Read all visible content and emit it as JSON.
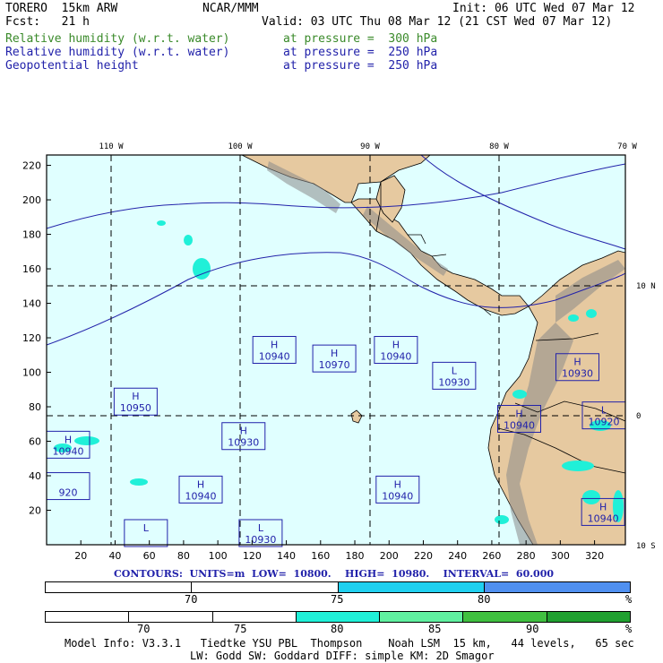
{
  "header": {
    "model": "TORERO  15km ARW",
    "org": "NCAR/MMM",
    "init": "Init: 06 UTC Wed 07 Mar 12",
    "fcst": "Fcst:   21 h",
    "valid": "Valid: 03 UTC Thu 08 Mar 12 (21 CST Wed 07 Mar 12)",
    "fields": [
      {
        "name": "Relative humidity (w.r.t. water)",
        "level": "at pressure =  300 hPa",
        "color": "#3a8a2a"
      },
      {
        "name": "Relative humidity (w.r.t. water)",
        "level": "at pressure =  250 hPa",
        "color": "#2222aa"
      },
      {
        "name": "Geopotential height",
        "level": "at pressure =  250 hPa",
        "color": "#2222aa"
      }
    ]
  },
  "map": {
    "lon_labels": [
      "110 W",
      "100 W",
      "90 W",
      "80 W",
      "70 W"
    ],
    "lat_labels": [
      "10 N",
      "0",
      "10 S"
    ],
    "y_ticks": [
      "220",
      "200",
      "180",
      "160",
      "140",
      "120",
      "100",
      "80",
      "60",
      "40",
      "20"
    ],
    "x_ticks": [
      "20",
      "40",
      "60",
      "80",
      "100",
      "120",
      "140",
      "160",
      "180",
      "200",
      "220",
      "240",
      "260",
      "280",
      "300",
      "320"
    ],
    "ocean_color": "#e0ffff",
    "land_color": "#e6c9a0",
    "contour_color": "#2222aa",
    "highs_lows": [
      {
        "type": "H",
        "value": "10940",
        "gx": 133,
        "gy": 113
      },
      {
        "type": "H",
        "value": "10970",
        "gx": 168,
        "gy": 108
      },
      {
        "type": "H",
        "value": "10940",
        "gx": 204,
        "gy": 113
      },
      {
        "type": "L",
        "value": "10930",
        "gx": 238,
        "gy": 98
      },
      {
        "type": "H",
        "value": "10930",
        "gx": 310,
        "gy": 103
      },
      {
        "type": "H",
        "value": "10950",
        "gx": 52,
        "gy": 83
      },
      {
        "type": "H",
        "value": "10940",
        "gx": 276,
        "gy": 73
      },
      {
        "type": "L",
        "value": "10920",
        "gx": 330,
        "gy": 75
      },
      {
        "type": "H",
        "value": "10930",
        "gx": 115,
        "gy": 63
      },
      {
        "type": "H",
        "value": "10940",
        "gx": 6,
        "gy": 58
      },
      {
        "type": "H",
        "value": "10940",
        "gx": 90,
        "gy": 32
      },
      {
        "type": "H",
        "value": "10940",
        "gx": 205,
        "gy": 32
      },
      {
        "type": "H",
        "value": "10940",
        "gx": 325,
        "gy": 19
      },
      {
        "type": "",
        "value": "920",
        "gx": 6,
        "gy": 34
      },
      {
        "type": "L",
        "value": "",
        "gx": 58,
        "gy": 3
      },
      {
        "type": "L",
        "value": "10930",
        "gx": 125,
        "gy": 3
      }
    ]
  },
  "contour_info": {
    "label": "CONTOURS:  UNITS=m  LOW=  10800.    HIGH=  10980.    INTERVAL=  60.000"
  },
  "colorbar1": {
    "labels": [
      "70",
      "75",
      "80",
      "%"
    ],
    "colors": [
      "#ffffff",
      "#ffffff",
      "#20d0f0",
      "#5090f0"
    ]
  },
  "colorbar2": {
    "labels": [
      "70",
      "75",
      "80",
      "85",
      "90",
      "%"
    ],
    "colors": [
      "#ffffff",
      "#ffffff",
      "#ffffff",
      "#20f0d8",
      "#60f0a0",
      "#40c040",
      "#20a030"
    ]
  },
  "footer": {
    "line1": "Model Info: V3.3.1   Tiedtke YSU PBL  Thompson    Noah LSM  15 km,   44 levels,   65 sec",
    "line2": "LW: Godd SW: Goddard DIFF: simple KM: 2D Smagor"
  }
}
